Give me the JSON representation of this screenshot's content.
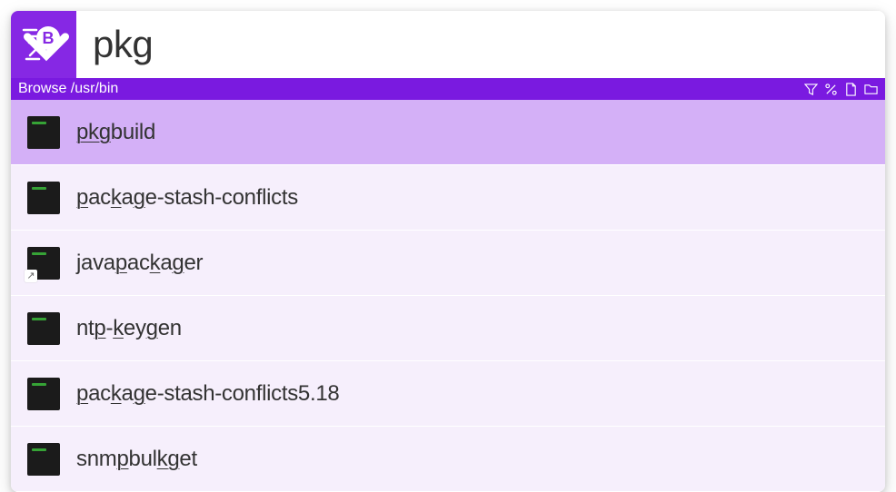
{
  "search": {
    "query": "pkg"
  },
  "breadcrumb": {
    "label": "Browse /usr/bin"
  },
  "results": [
    {
      "selected": true,
      "shortcut": false,
      "segments": [
        {
          "t": "pkg",
          "m": true
        },
        {
          "t": "build",
          "m": false
        }
      ]
    },
    {
      "selected": false,
      "shortcut": false,
      "segments": [
        {
          "t": "p",
          "m": true
        },
        {
          "t": "ac",
          "m": false
        },
        {
          "t": "k",
          "m": true
        },
        {
          "t": "a",
          "m": false
        },
        {
          "t": "g",
          "m": true
        },
        {
          "t": "e-stash-conflicts",
          "m": false
        }
      ]
    },
    {
      "selected": false,
      "shortcut": true,
      "segments": [
        {
          "t": "java",
          "m": false
        },
        {
          "t": "p",
          "m": true
        },
        {
          "t": "ac",
          "m": false
        },
        {
          "t": "k",
          "m": true
        },
        {
          "t": "a",
          "m": false
        },
        {
          "t": "g",
          "m": true
        },
        {
          "t": "er",
          "m": false
        }
      ]
    },
    {
      "selected": false,
      "shortcut": false,
      "segments": [
        {
          "t": "nt",
          "m": false
        },
        {
          "t": "p",
          "m": true
        },
        {
          "t": "-",
          "m": false
        },
        {
          "t": "k",
          "m": true
        },
        {
          "t": "ey",
          "m": false
        },
        {
          "t": "g",
          "m": true
        },
        {
          "t": "en",
          "m": false
        }
      ]
    },
    {
      "selected": false,
      "shortcut": false,
      "segments": [
        {
          "t": "p",
          "m": true
        },
        {
          "t": "ac",
          "m": false
        },
        {
          "t": "k",
          "m": true
        },
        {
          "t": "a",
          "m": false
        },
        {
          "t": "g",
          "m": true
        },
        {
          "t": "e-stash-conflicts5.18",
          "m": false
        }
      ]
    },
    {
      "selected": false,
      "shortcut": false,
      "segments": [
        {
          "t": "snm",
          "m": false
        },
        {
          "t": "p",
          "m": true
        },
        {
          "t": "bul",
          "m": false
        },
        {
          "t": "k",
          "m": true
        },
        {
          "t": "g",
          "m": true
        },
        {
          "t": "et",
          "m": false
        }
      ]
    }
  ]
}
